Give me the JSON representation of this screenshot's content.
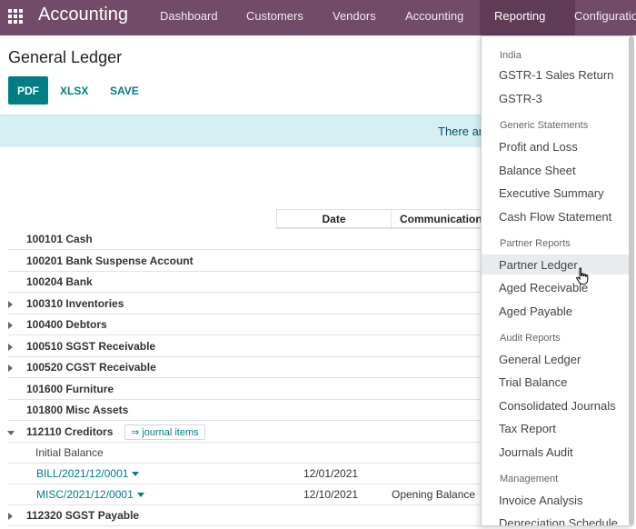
{
  "topbar": {
    "app_title": "Accounting",
    "nav": [
      "Dashboard",
      "Customers",
      "Vendors",
      "Accounting",
      "Reporting",
      "Configuration"
    ]
  },
  "page": {
    "title": "General Ledger",
    "buttons": {
      "pdf": "PDF",
      "xlsx": "XLSX",
      "save": "SAVE"
    },
    "alert_text": "There ar"
  },
  "table": {
    "headers": {
      "date": "Date",
      "communication": "Communication"
    },
    "rows": [
      {
        "label": "100101 Cash"
      },
      {
        "label": "100201 Bank Suspense Account"
      },
      {
        "label": "100204 Bank"
      },
      {
        "label": "100310 Inventories"
      },
      {
        "label": "100400 Debtors"
      },
      {
        "label": "100510 SGST Receivable"
      },
      {
        "label": "100520 CGST Receivable"
      },
      {
        "label": "101600 Furniture"
      },
      {
        "label": "101800 Misc Assets"
      },
      {
        "label": "112110 Creditors",
        "badge": "⇒ journal items"
      },
      {
        "label": "Initial Balance"
      },
      {
        "label": "BILL/2021/12/0001",
        "date": "12/01/2021",
        "comm": ""
      },
      {
        "label": "MISC/2021/12/0001",
        "date": "12/10/2021",
        "comm": "Opening Balance"
      },
      {
        "label": "112320 SGST Payable"
      }
    ]
  },
  "dropdown": {
    "sections": [
      {
        "header": "India",
        "items": [
          "GSTR-1 Sales Return",
          "GSTR-3"
        ]
      },
      {
        "header": "Generic Statements",
        "items": [
          "Profit and Loss",
          "Balance Sheet",
          "Executive Summary",
          "Cash Flow Statement"
        ]
      },
      {
        "header": "Partner Reports",
        "items": [
          "Partner Ledger",
          "Aged Receivable",
          "Aged Payable"
        ]
      },
      {
        "header": "Audit Reports",
        "items": [
          "General Ledger",
          "Trial Balance",
          "Consolidated Journals",
          "Tax Report",
          "Journals Audit"
        ]
      },
      {
        "header": "Management",
        "items": [
          "Invoice Analysis",
          "Depreciation Schedule"
        ]
      }
    ]
  },
  "colors": {
    "brand": "#714b67",
    "accent": "#017e84"
  }
}
